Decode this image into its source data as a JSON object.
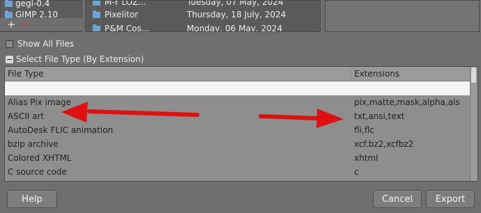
{
  "places": {
    "items": [
      {
        "label": "gegl-0.4"
      },
      {
        "label": "GIMP 2.10"
      }
    ]
  },
  "files": {
    "rows": [
      {
        "name": "M-Y LOZ...",
        "date": "Tuesday, 07 May, 2024"
      },
      {
        "name": "Pixelitor",
        "date": "Thursday, 18 July, 2024"
      },
      {
        "name": "P&M Cos...",
        "date": "Monday, 06 May, 2024"
      }
    ]
  },
  "options": {
    "show_all_files": "Show All Files",
    "select_file_type": "Select File Type (By Extension)"
  },
  "table": {
    "headers": {
      "type": "File Type",
      "extensions": "Extensions"
    },
    "rows": [
      {
        "type": "",
        "ext": ""
      },
      {
        "type": "Alias Pix image",
        "ext": "pix,matte,mask,alpha,als"
      },
      {
        "type": "ASCII art",
        "ext": "txt,ansi,text"
      },
      {
        "type": "AutoDesk FLIC animation",
        "ext": "fli,flc"
      },
      {
        "type": "bzip archive",
        "ext": "xcf.bz2,xcfbz2"
      },
      {
        "type": "Colored XHTML",
        "ext": "xhtml"
      },
      {
        "type": "C source code",
        "ext": "c"
      }
    ]
  },
  "buttons": {
    "help": "Help",
    "cancel": "Cancel",
    "export": "Export"
  },
  "colors": {
    "annotation_arrow": "#e01010",
    "folder_icon": "#6fa3d6",
    "selected_row": "#f4f4f4"
  }
}
